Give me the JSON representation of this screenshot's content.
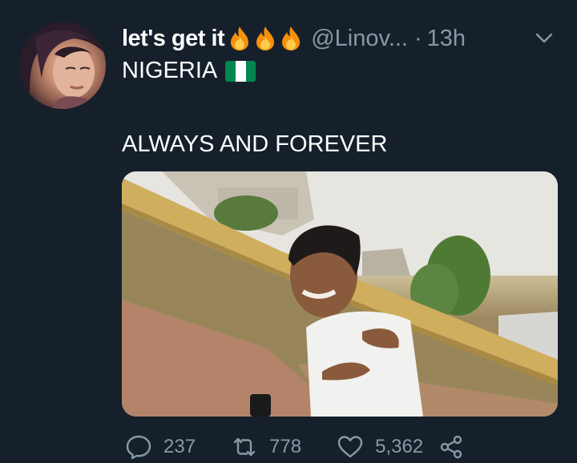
{
  "tweet": {
    "display_name": "let's get it",
    "display_name_emojis": [
      "fire-emoji",
      "fire-emoji",
      "fire-emoji"
    ],
    "handle": "@Linov...",
    "separator": "·",
    "time": "13h",
    "bio_line": "NIGERIA",
    "bio_flag": "nigeria-flag",
    "text": "ALWAYS AND FOREVER"
  },
  "actions": {
    "reply_count": "237",
    "retweet_count": "778",
    "like_count": "5,362"
  },
  "colors": {
    "background": "#15202b",
    "text": "#ffffff",
    "muted": "#8899a6",
    "flag_green": "#008751",
    "flag_white": "#ffffff"
  },
  "icons": [
    "reply-icon",
    "retweet-icon",
    "like-icon",
    "share-icon",
    "chevron-down-icon"
  ]
}
